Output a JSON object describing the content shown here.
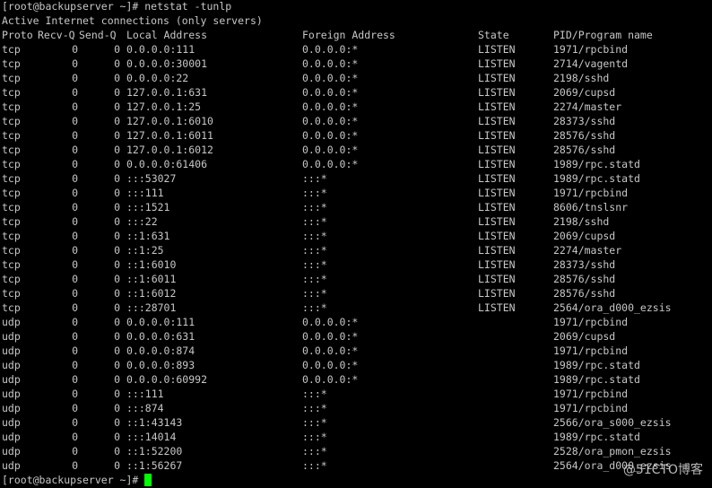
{
  "terminal": {
    "command_line": "[root@backupserver ~]# netstat -tunlp",
    "title_line": "Active Internet connections (only servers)",
    "prompt_line": "[root@backupserver ~]# ",
    "cursor_color": "#00ff00",
    "background_color": "#000000",
    "text_color": "#c7c7c7"
  },
  "table": {
    "headers": {
      "proto": "Proto",
      "recv": "Recv-Q",
      "send": "Send-Q",
      "local": "Local Address",
      "foreign": "Foreign Address",
      "state": "State",
      "pid": "PID/Program name"
    },
    "rows": [
      {
        "proto": "tcp",
        "recv": "0",
        "send": "0",
        "local": "0.0.0.0:111",
        "foreign": "0.0.0.0:*",
        "state": "LISTEN",
        "pid": "1971/rpcbind"
      },
      {
        "proto": "tcp",
        "recv": "0",
        "send": "0",
        "local": "0.0.0.0:30001",
        "foreign": "0.0.0.0:*",
        "state": "LISTEN",
        "pid": "2714/vagentd"
      },
      {
        "proto": "tcp",
        "recv": "0",
        "send": "0",
        "local": "0.0.0.0:22",
        "foreign": "0.0.0.0:*",
        "state": "LISTEN",
        "pid": "2198/sshd"
      },
      {
        "proto": "tcp",
        "recv": "0",
        "send": "0",
        "local": "127.0.0.1:631",
        "foreign": "0.0.0.0:*",
        "state": "LISTEN",
        "pid": "2069/cupsd"
      },
      {
        "proto": "tcp",
        "recv": "0",
        "send": "0",
        "local": "127.0.0.1:25",
        "foreign": "0.0.0.0:*",
        "state": "LISTEN",
        "pid": "2274/master"
      },
      {
        "proto": "tcp",
        "recv": "0",
        "send": "0",
        "local": "127.0.0.1:6010",
        "foreign": "0.0.0.0:*",
        "state": "LISTEN",
        "pid": "28373/sshd"
      },
      {
        "proto": "tcp",
        "recv": "0",
        "send": "0",
        "local": "127.0.0.1:6011",
        "foreign": "0.0.0.0:*",
        "state": "LISTEN",
        "pid": "28576/sshd"
      },
      {
        "proto": "tcp",
        "recv": "0",
        "send": "0",
        "local": "127.0.0.1:6012",
        "foreign": "0.0.0.0:*",
        "state": "LISTEN",
        "pid": "28576/sshd"
      },
      {
        "proto": "tcp",
        "recv": "0",
        "send": "0",
        "local": "0.0.0.0:61406",
        "foreign": "0.0.0.0:*",
        "state": "LISTEN",
        "pid": "1989/rpc.statd"
      },
      {
        "proto": "tcp",
        "recv": "0",
        "send": "0",
        "local": ":::53027",
        "foreign": ":::*",
        "state": "LISTEN",
        "pid": "1989/rpc.statd"
      },
      {
        "proto": "tcp",
        "recv": "0",
        "send": "0",
        "local": ":::111",
        "foreign": ":::*",
        "state": "LISTEN",
        "pid": "1971/rpcbind"
      },
      {
        "proto": "tcp",
        "recv": "0",
        "send": "0",
        "local": ":::1521",
        "foreign": ":::*",
        "state": "LISTEN",
        "pid": "8606/tnslsnr"
      },
      {
        "proto": "tcp",
        "recv": "0",
        "send": "0",
        "local": ":::22",
        "foreign": ":::*",
        "state": "LISTEN",
        "pid": "2198/sshd"
      },
      {
        "proto": "tcp",
        "recv": "0",
        "send": "0",
        "local": "::1:631",
        "foreign": ":::*",
        "state": "LISTEN",
        "pid": "2069/cupsd"
      },
      {
        "proto": "tcp",
        "recv": "0",
        "send": "0",
        "local": "::1:25",
        "foreign": ":::*",
        "state": "LISTEN",
        "pid": "2274/master"
      },
      {
        "proto": "tcp",
        "recv": "0",
        "send": "0",
        "local": "::1:6010",
        "foreign": ":::*",
        "state": "LISTEN",
        "pid": "28373/sshd"
      },
      {
        "proto": "tcp",
        "recv": "0",
        "send": "0",
        "local": "::1:6011",
        "foreign": ":::*",
        "state": "LISTEN",
        "pid": "28576/sshd"
      },
      {
        "proto": "tcp",
        "recv": "0",
        "send": "0",
        "local": "::1:6012",
        "foreign": ":::*",
        "state": "LISTEN",
        "pid": "28576/sshd"
      },
      {
        "proto": "tcp",
        "recv": "0",
        "send": "0",
        "local": ":::28701",
        "foreign": ":::*",
        "state": "LISTEN",
        "pid": "2564/ora_d000_ezsis"
      },
      {
        "proto": "udp",
        "recv": "0",
        "send": "0",
        "local": "0.0.0.0:111",
        "foreign": "0.0.0.0:*",
        "state": "",
        "pid": "1971/rpcbind"
      },
      {
        "proto": "udp",
        "recv": "0",
        "send": "0",
        "local": "0.0.0.0:631",
        "foreign": "0.0.0.0:*",
        "state": "",
        "pid": "2069/cupsd"
      },
      {
        "proto": "udp",
        "recv": "0",
        "send": "0",
        "local": "0.0.0.0:874",
        "foreign": "0.0.0.0:*",
        "state": "",
        "pid": "1971/rpcbind"
      },
      {
        "proto": "udp",
        "recv": "0",
        "send": "0",
        "local": "0.0.0.0:893",
        "foreign": "0.0.0.0:*",
        "state": "",
        "pid": "1989/rpc.statd"
      },
      {
        "proto": "udp",
        "recv": "0",
        "send": "0",
        "local": "0.0.0.0:60992",
        "foreign": "0.0.0.0:*",
        "state": "",
        "pid": "1989/rpc.statd"
      },
      {
        "proto": "udp",
        "recv": "0",
        "send": "0",
        "local": ":::111",
        "foreign": ":::*",
        "state": "",
        "pid": "1971/rpcbind"
      },
      {
        "proto": "udp",
        "recv": "0",
        "send": "0",
        "local": ":::874",
        "foreign": ":::*",
        "state": "",
        "pid": "1971/rpcbind"
      },
      {
        "proto": "udp",
        "recv": "0",
        "send": "0",
        "local": "::1:43143",
        "foreign": ":::*",
        "state": "",
        "pid": "2566/ora_s000_ezsis"
      },
      {
        "proto": "udp",
        "recv": "0",
        "send": "0",
        "local": ":::14014",
        "foreign": ":::*",
        "state": "",
        "pid": "1989/rpc.statd"
      },
      {
        "proto": "udp",
        "recv": "0",
        "send": "0",
        "local": "::1:52200",
        "foreign": ":::*",
        "state": "",
        "pid": "2528/ora_pmon_ezsis"
      },
      {
        "proto": "udp",
        "recv": "0",
        "send": "0",
        "local": "::1:56267",
        "foreign": ":::*",
        "state": "",
        "pid": "2564/ora_d000_ezsis"
      }
    ]
  },
  "watermark": {
    "text": "@51CTO博客"
  }
}
